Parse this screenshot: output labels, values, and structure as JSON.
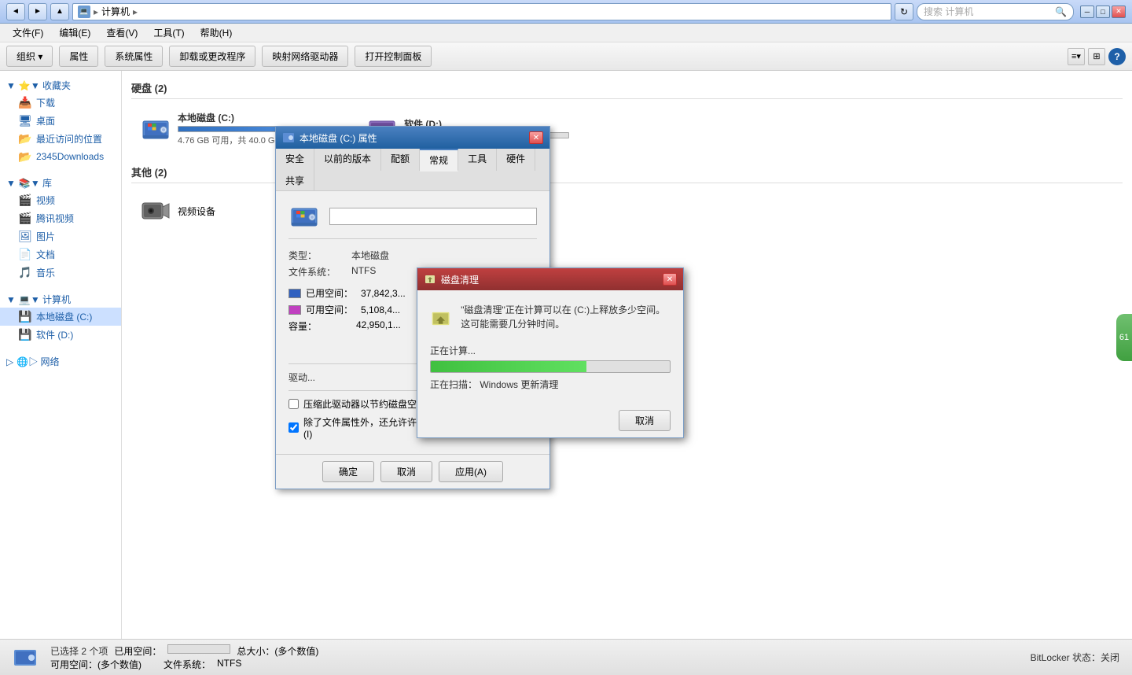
{
  "window": {
    "title": "计算机",
    "address": "计算机",
    "search_placeholder": "搜索 计算机"
  },
  "titlebar": {
    "back_label": "◄",
    "forward_label": "►",
    "refresh_label": "↻",
    "nav_arrow": "▸",
    "minimize": "─",
    "maximize": "□",
    "close": "✕"
  },
  "menu": {
    "items": [
      "文件(F)",
      "编辑(E)",
      "查看(V)",
      "工具(T)",
      "帮助(H)"
    ]
  },
  "toolbar": {
    "organize": "组织 ▾",
    "properties": "属性",
    "system_props": "系统属性",
    "uninstall": "卸载或更改程序",
    "map_drive": "映射网络驱动器",
    "control_panel": "打开控制面板",
    "help": "?"
  },
  "sidebar": {
    "favorites_label": "▼ 收藏夹",
    "favorites": [
      {
        "label": "下载",
        "icon": "📥"
      },
      {
        "label": "桌面",
        "icon": "🖥"
      },
      {
        "label": "最近访问的位置",
        "icon": "📂"
      },
      {
        "label": "2345Downloads",
        "icon": "📂"
      }
    ],
    "library_label": "▼ 库",
    "library": [
      {
        "label": "视频",
        "icon": "🎬"
      },
      {
        "label": "腾讯视频",
        "icon": "🎬"
      },
      {
        "label": "图片",
        "icon": "🖼"
      },
      {
        "label": "文档",
        "icon": "📄"
      },
      {
        "label": "音乐",
        "icon": "🎵"
      }
    ],
    "computer_label": "▼ 计算机",
    "computer": [
      {
        "label": "本地磁盘 (C:)",
        "icon": "💾"
      },
      {
        "label": "软件 (D:)",
        "icon": "💾"
      }
    ],
    "network_label": "▷ 网络"
  },
  "content": {
    "hard_disk_section": "硬盘 (2)",
    "drives": [
      {
        "name": "本地磁盘 (C:)",
        "free": "4.76 GB 可用，共 40.0 G",
        "bar_pct": 88,
        "bar_type": "normal"
      },
      {
        "name": "软件 (D:)",
        "bar_pct": 50,
        "bar_type": "software"
      }
    ],
    "other_section": "其他 (2)",
    "other_items": [
      {
        "label": "视频设备"
      }
    ]
  },
  "status": {
    "selected": "已选择 2 个项",
    "used_space_label": "已用空间：",
    "free_space_label": "可用空间：(多个数值)",
    "total_size_label": "总大小：(多个数值)",
    "bitlocker": "BitLocker 状态：关闭",
    "filesystem_label": "文件系统：",
    "filesystem": "NTFS"
  },
  "properties_dialog": {
    "title": "本地磁盘 (C:) 属性",
    "tabs": [
      "安全",
      "以前的版本",
      "配额",
      "常规",
      "工具",
      "硬件",
      "共享"
    ],
    "active_tab": "常规",
    "drive_name": "",
    "type_label": "类型：",
    "type_value": "本地磁盘",
    "fs_label": "文件系统：",
    "fs_value": "NTFS",
    "used_label": "已用空间：",
    "used_value": "37,842,3...",
    "free_label": "可用空间：",
    "free_value": "5,108,4...",
    "capacity_label": "容量：",
    "capacity_value": "42,950,1...",
    "drive_label": "驱动...",
    "compress_label": "压缩此驱动器以节约磁盘空间(C)",
    "index_label": "除了文件属性外，还允许许索引此驱动器上文件的内容(I)",
    "index_checked": true,
    "buttons": {
      "ok": "确定",
      "cancel": "取消",
      "apply": "应用(A)"
    }
  },
  "cleanup_dialog": {
    "title": "磁盘清理",
    "message": "\"磁盘清理\"正在计算可以在 (C:)上释放多少空间。这可能需要几分钟时间。",
    "calculating": "正在计算...",
    "scanning": "正在扫描：  Windows 更新清理",
    "progress_pct": 65,
    "cancel_label": "取消"
  },
  "right_panel": {
    "value": "61"
  }
}
